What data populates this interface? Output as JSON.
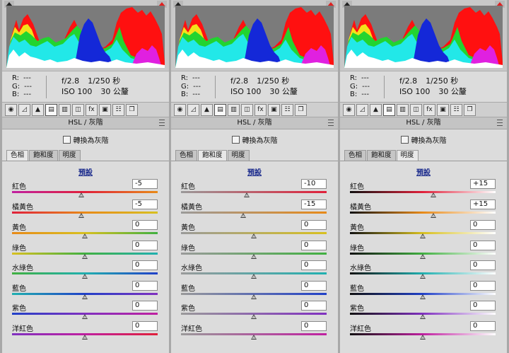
{
  "panels": [
    {
      "exif": {
        "aperture": "f/2.8",
        "shutter": "1/250 秒",
        "iso": "ISO 100",
        "focal": "30 公釐"
      },
      "rgb": [
        {
          "label": "R:",
          "value": "---"
        },
        {
          "label": "G:",
          "value": "---"
        },
        {
          "label": "B:",
          "value": "---"
        }
      ],
      "panel_title": "HSL / 灰階",
      "grayscale_label": "轉換為灰階",
      "tabs": [
        "色相",
        "飽和度",
        "明度"
      ],
      "active_tab": 0,
      "preset_label": "預設",
      "sliders": [
        {
          "label": "紅色",
          "value": "-5",
          "fraction": 0.475
        },
        {
          "label": "橘黃色",
          "value": "-5",
          "fraction": 0.475
        },
        {
          "label": "黃色",
          "value": "0",
          "fraction": 0.5
        },
        {
          "label": "綠色",
          "value": "0",
          "fraction": 0.5
        },
        {
          "label": "水綠色",
          "value": "0",
          "fraction": 0.5
        },
        {
          "label": "藍色",
          "value": "0",
          "fraction": 0.5
        },
        {
          "label": "紫色",
          "value": "0",
          "fraction": 0.5
        },
        {
          "label": "洋紅色",
          "value": "0",
          "fraction": 0.5
        }
      ]
    },
    {
      "exif": {
        "aperture": "f/2.8",
        "shutter": "1/250 秒",
        "iso": "ISO 100",
        "focal": "30 公釐"
      },
      "rgb": [
        {
          "label": "R:",
          "value": "---"
        },
        {
          "label": "G:",
          "value": "---"
        },
        {
          "label": "B:",
          "value": "---"
        }
      ],
      "panel_title": "HSL / 灰階",
      "grayscale_label": "轉換為灰階",
      "tabs": [
        "色相",
        "飽和度",
        "明度"
      ],
      "active_tab": 1,
      "preset_label": "預設",
      "sliders": [
        {
          "label": "紅色",
          "value": "-10",
          "fraction": 0.45
        },
        {
          "label": "橘黃色",
          "value": "-15",
          "fraction": 0.425
        },
        {
          "label": "黃色",
          "value": "0",
          "fraction": 0.5
        },
        {
          "label": "綠色",
          "value": "0",
          "fraction": 0.5
        },
        {
          "label": "水綠色",
          "value": "0",
          "fraction": 0.5
        },
        {
          "label": "藍色",
          "value": "0",
          "fraction": 0.5
        },
        {
          "label": "紫色",
          "value": "0",
          "fraction": 0.5
        },
        {
          "label": "洋紅色",
          "value": "0",
          "fraction": 0.5
        }
      ]
    },
    {
      "exif": {
        "aperture": "f/2.8",
        "shutter": "1/250 秒",
        "iso": "ISO 100",
        "focal": "30 公釐"
      },
      "rgb": [
        {
          "label": "R:",
          "value": "---"
        },
        {
          "label": "G:",
          "value": "---"
        },
        {
          "label": "B:",
          "value": "---"
        }
      ],
      "panel_title": "HSL / 灰階",
      "grayscale_label": "轉換為灰階",
      "tabs": [
        "色相",
        "飽和度",
        "明度"
      ],
      "active_tab": 2,
      "preset_label": "預設",
      "sliders": [
        {
          "label": "紅色",
          "value": "+15",
          "fraction": 0.575
        },
        {
          "label": "橘黃色",
          "value": "+15",
          "fraction": 0.575
        },
        {
          "label": "黃色",
          "value": "0",
          "fraction": 0.5
        },
        {
          "label": "綠色",
          "value": "0",
          "fraction": 0.5
        },
        {
          "label": "水綠色",
          "value": "0",
          "fraction": 0.5
        },
        {
          "label": "藍色",
          "value": "0",
          "fraction": 0.5
        },
        {
          "label": "紫色",
          "value": "0",
          "fraction": 0.5
        },
        {
          "label": "洋紅色",
          "value": "0",
          "fraction": 0.5
        }
      ]
    }
  ],
  "toolbar_icons": [
    "basic-icon",
    "tone-curve-icon",
    "detail-icon",
    "hsl-icon",
    "split-toning-icon",
    "lens-corrections-icon",
    "fx-icon",
    "camera-calibration-icon",
    "presets-icon",
    "snapshots-icon"
  ],
  "track_colors": [
    "#e0203a",
    "#e88a18",
    "#d8c020",
    "#40b040",
    "#20b0b0",
    "#2040c8",
    "#8030c0",
    "#c020a0"
  ],
  "histogram_colors": {
    "red": "#ff1010",
    "yellow": "#f2e21a",
    "green": "#22d430",
    "cyan": "#22e8e8",
    "blue": "#1428d8",
    "magenta": "#e020e0",
    "white": "#ffffff",
    "background": "#7b7b7b"
  }
}
